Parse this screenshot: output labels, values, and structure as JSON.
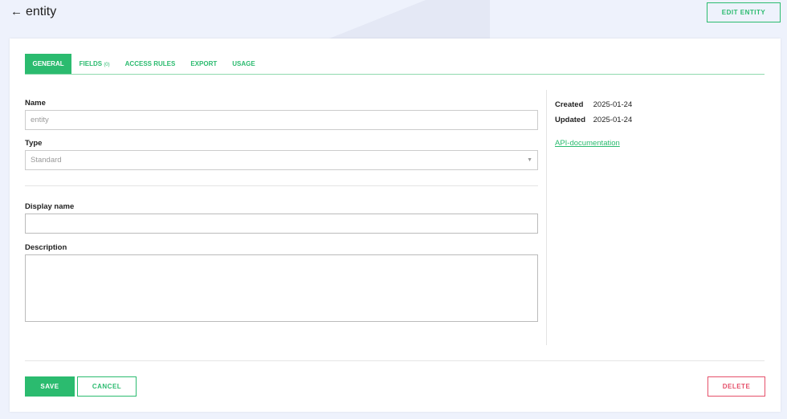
{
  "header": {
    "back_icon": "arrow-left-icon",
    "title": "entity",
    "edit_label": "EDIT ENTITY"
  },
  "tabs": [
    {
      "label": "GENERAL"
    },
    {
      "label": "FIELDS",
      "count": "(0)"
    },
    {
      "label": "ACCESS RULES"
    },
    {
      "label": "EXPORT"
    },
    {
      "label": "USAGE"
    }
  ],
  "form": {
    "name_label": "Name",
    "name_value": "entity",
    "type_label": "Type",
    "type_value": "Standard",
    "display_label": "Display name",
    "display_value": "",
    "desc_label": "Description",
    "desc_value": ""
  },
  "meta": {
    "created_label": "Created",
    "created": "2025-01-24",
    "updated_label": "Updated",
    "updated": "2025-01-24",
    "api_link": "API-documentation"
  },
  "actions": {
    "save": "SAVE",
    "cancel": "CANCEL",
    "delete": "DELETE"
  },
  "colors": {
    "accent": "#2bbb6f",
    "danger": "#e5506a"
  }
}
